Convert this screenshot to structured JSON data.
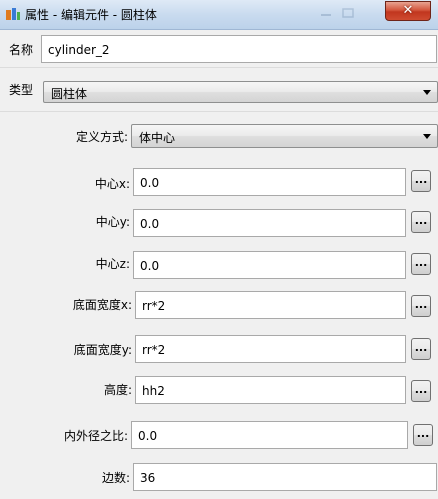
{
  "window": {
    "title": "属性 - 编辑元件 - 圆柱体",
    "close_glyph": "✕",
    "accent": "#c1361f"
  },
  "fields": {
    "name": {
      "label": "名称",
      "value": "cylinder_2"
    },
    "type": {
      "label": "类型",
      "value": "圆柱体"
    },
    "define": {
      "label": "定义方式:",
      "value": "体中心"
    },
    "center_x": {
      "label": "中心x:",
      "value": "0.0"
    },
    "center_y": {
      "label": "中心y:",
      "value": "0.0"
    },
    "center_z": {
      "label": "中心z:",
      "value": "0.0"
    },
    "base_width_x": {
      "label": "底面宽度x:",
      "value": "rr*2"
    },
    "base_width_y": {
      "label": "底面宽度y:",
      "value": "rr*2"
    },
    "height": {
      "label": "高度:",
      "value": "hh2"
    },
    "ratio": {
      "label": "内外径之比:",
      "value": "0.0"
    },
    "edges": {
      "label": "边数:",
      "value": "36"
    }
  },
  "browse_label": "...",
  "icons": {
    "app": "cylinder-app-icon",
    "dropdown": "chevron-down-icon"
  }
}
